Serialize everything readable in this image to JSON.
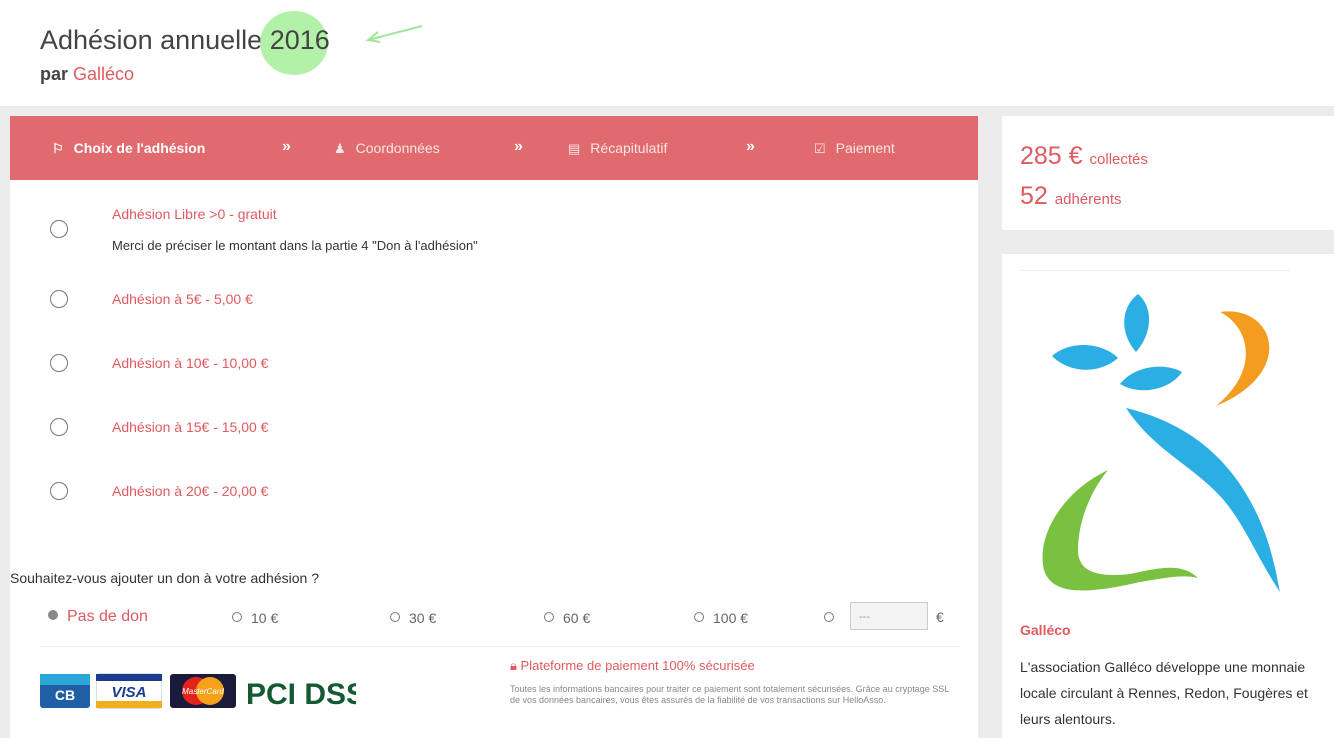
{
  "header": {
    "title_prefix": "Adhésion annuelle ",
    "title_year": "2016",
    "subtitle_prefix": "par ",
    "subtitle_org": "Galléco"
  },
  "steps": [
    {
      "label": "Choix de l'adhésion",
      "icon": "flag-icon",
      "active": true
    },
    {
      "label": "Coordonnées",
      "icon": "user-icon",
      "active": false
    },
    {
      "label": "Récapitulatif",
      "icon": "list-icon",
      "active": false
    },
    {
      "label": "Paiement",
      "icon": "check-square-icon",
      "active": false
    }
  ],
  "step_separator": "»",
  "options": [
    {
      "label": "Adhésion Libre >0 - gratuit",
      "desc": "Merci de préciser le montant dans la partie 4 \"Don à l'adhésion\""
    },
    {
      "label": "Adhésion à 5€ - 5,00 €"
    },
    {
      "label": "Adhésion à 10€ - 10,00 €"
    },
    {
      "label": "Adhésion à 15€ - 15,00 €"
    },
    {
      "label": "Adhésion à 20€ - 20,00 €"
    }
  ],
  "donation": {
    "question": "Souhaitez-vous ajouter un don à votre adhésion ?",
    "choices": [
      "Pas de don",
      "10 €",
      "30 €",
      "60 €",
      "100 €"
    ],
    "selected": "Pas de don",
    "custom_placeholder": "---",
    "currency": "€"
  },
  "payment": {
    "cards": [
      "CB",
      "VISA",
      "MasterCard",
      "PCI DSS"
    ],
    "secure_title": "Plateforme de paiement 100% sécurisée",
    "secure_text": "Toutes les informations bancaires pour traiter ce paiement sont totalement sécurisées. Grâce au cryptage SSL de vos données bancaires, vous êtes assurés de la fiabilité de vos transactions sur HelloAsso."
  },
  "stats": {
    "amount": "285 €",
    "amount_label": "collectés",
    "members": "52",
    "members_label": "adhérents"
  },
  "org": {
    "name": "Galléco",
    "description": "L'association Galléco développe une monnaie locale circulant à Rennes, Redon, Fougères et leurs alentours."
  },
  "colors": {
    "accent": "#e05a5f",
    "steps_bar": "#e06a6e",
    "year_highlight": "#a6ef9a"
  }
}
